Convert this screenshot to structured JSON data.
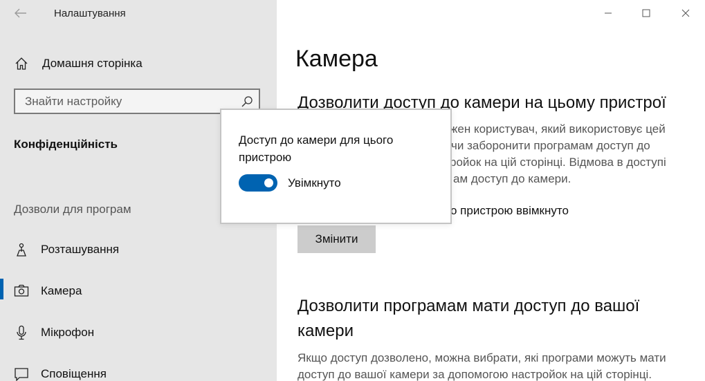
{
  "window": {
    "title": "Налаштування",
    "controls": [
      "minimize-icon",
      "maximize-icon",
      "close-icon"
    ]
  },
  "sidebar": {
    "home_label": "Домашня сторінка",
    "search": {
      "placeholder": "Знайти настройку",
      "value": ""
    },
    "section_title": "Конфіденційність",
    "group_title": "Дозволи для програм",
    "items": [
      {
        "label": "Розташування",
        "icon": "location-icon",
        "selected": false
      },
      {
        "label": "Камера",
        "icon": "camera-icon",
        "selected": true
      },
      {
        "label": "Мікрофон",
        "icon": "microphone-icon",
        "selected": false
      },
      {
        "label": "Сповіщення",
        "icon": "notification-icon",
        "selected": false
      }
    ]
  },
  "main": {
    "title": "Камера",
    "section1": {
      "heading": "Дозволити доступ до камери на цьому пристрої",
      "desc_lines": [
        "жен користувач, який використовує цей",
        "чи заборонити програмам доступ до",
        "ройок на цій сторінці. Відмова в доступі",
        "ам доступ до камери."
      ],
      "status_visible": "о пристрою ввімкнуто",
      "button_label": "Змінити"
    },
    "section2": {
      "heading_line1": "Дозволити програмам мати доступ до вашої",
      "heading_line2": "камери",
      "desc_line1": "Якщо доступ дозволено, можна вибрати, які програми можуть мати",
      "desc_line2": "доступ до вашої камери за допомогою настройок на цій сторінці."
    }
  },
  "flyout": {
    "text": "Доступ до камери для цього пристрою",
    "toggle_state": "on",
    "toggle_label": "Увімкнуто"
  },
  "colors": {
    "accent": "#0063b1",
    "sidebar_bg": "#e6e6e6",
    "button_bg": "#cccccc"
  }
}
